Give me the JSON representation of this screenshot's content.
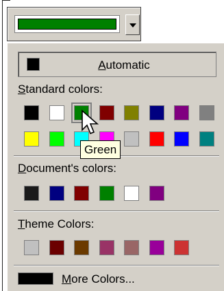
{
  "dropdown": {
    "selected_color": "#008000"
  },
  "automatic": {
    "label_pre": "",
    "label_underlined": "A",
    "label_post": "utomatic",
    "color": "#000000"
  },
  "standard": {
    "title_underlined": "S",
    "title_rest": "tandard colors:",
    "colors": [
      "#000000",
      "#ffffff",
      "#008000",
      "#800000",
      "#808000",
      "#000080",
      "#800080",
      "#808080",
      "#ffff00",
      "#00ff00",
      "#00ffff",
      "#ff00ff",
      "#c0c0c0",
      "#ff0000",
      "#0000ff",
      "#008080"
    ],
    "selected_index": 2
  },
  "document": {
    "title_underlined": "D",
    "title_rest": "ocument's colors:",
    "colors": [
      "#1a1a1a",
      "#000080",
      "#800000",
      "#008000",
      "#ffffff",
      "#800080"
    ]
  },
  "theme": {
    "title_underlined": "T",
    "title_rest": "heme Colors:",
    "colors": [
      "#c0c0c0",
      "#6b0000",
      "#6b3a00",
      "#993366",
      "#996666",
      "#99009a",
      "#cc3333"
    ]
  },
  "more": {
    "label_underlined": "M",
    "label_rest": "ore Colors...",
    "color": "#000000"
  },
  "tooltip": {
    "text": "Green"
  }
}
